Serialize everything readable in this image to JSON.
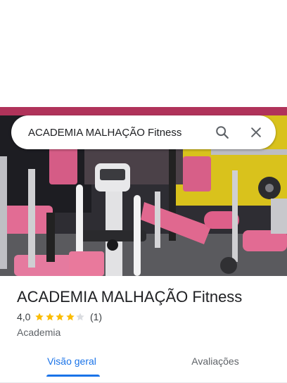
{
  "search": {
    "query": "ACADEMIA MALHAÇÃO Fitness",
    "search_icon": "search-icon",
    "close_icon": "close-icon"
  },
  "place": {
    "name": "ACADEMIA MALHAÇÃO Fitness",
    "rating": "4,0",
    "stars": 4,
    "max_stars": 5,
    "review_count": "(1)",
    "category": "Academia"
  },
  "tabs": [
    {
      "label": "Visão geral",
      "active": true
    },
    {
      "label": "Avaliações",
      "active": false
    }
  ],
  "colors": {
    "accent": "#1a73e8",
    "star": "#fbbc04",
    "star_empty": "#dadce0",
    "text": "#202124",
    "secondary": "#5f6368"
  }
}
